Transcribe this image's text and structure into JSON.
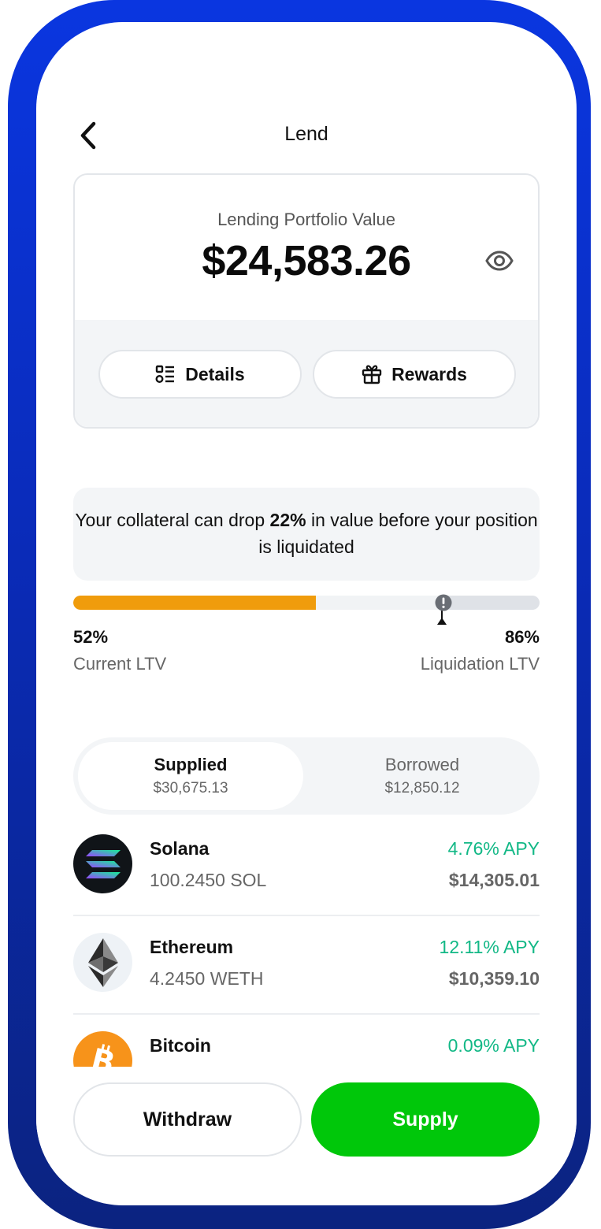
{
  "header": {
    "title": "Lend"
  },
  "portfolio": {
    "label": "Lending Portfolio Value",
    "value": "$24,583.26",
    "details_label": "Details",
    "rewards_label": "Rewards"
  },
  "collateral": {
    "prefix": "Your collateral can drop ",
    "drop_percent": "22%",
    "suffix": " in value before your position is liquidated"
  },
  "ltv": {
    "current_value": "52%",
    "current_label": "Current LTV",
    "liquidation_value": "86%",
    "liquidation_label": "Liquidation LTV",
    "current_fraction": 0.52,
    "liquidation_fraction": 0.86
  },
  "tabs": {
    "supplied": {
      "label": "Supplied",
      "amount": "$30,675.13",
      "active": true
    },
    "borrowed": {
      "label": "Borrowed",
      "amount": "$12,850.12",
      "active": false
    }
  },
  "assets": [
    {
      "name": "Solana",
      "amount": "100.2450 SOL",
      "apy": "4.76% APY",
      "value": "$14,305.01",
      "icon": "solana-icon"
    },
    {
      "name": "Ethereum",
      "amount": "4.2450 WETH",
      "apy": "12.11% APY",
      "value": "$10,359.10",
      "icon": "ethereum-icon"
    },
    {
      "name": "Bitcoin",
      "amount": "",
      "apy": "0.09% APY",
      "value": "",
      "icon": "bitcoin-icon"
    }
  ],
  "actions": {
    "withdraw_label": "Withdraw",
    "supply_label": "Supply"
  },
  "colors": {
    "frame": "#0a36e0",
    "ltv_fill": "#f09c0c",
    "apy_green": "#12b886",
    "supply_green": "#00c70a"
  }
}
